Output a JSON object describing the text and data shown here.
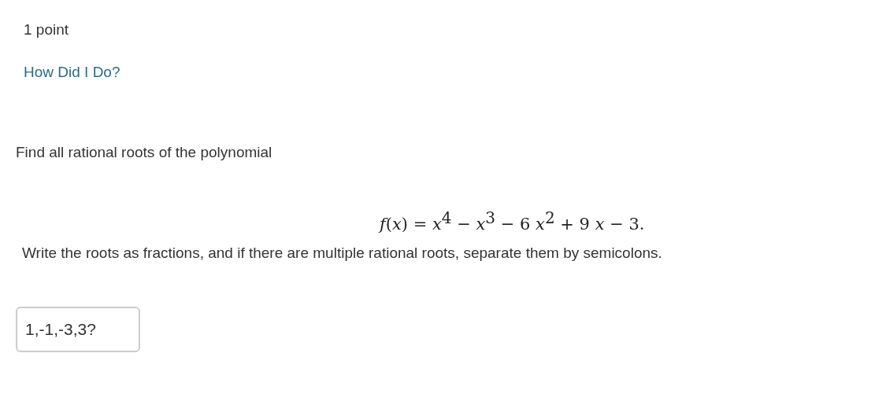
{
  "points": "1 point",
  "feedback_link": "How Did I Do?",
  "question": "Find all rational roots of the polynomial",
  "formula": "*f*(*x*) = *x*$^{4}$ − *x*$^{3}$ − 6 *x*$^{2}$ + 9 *x* − 3.",
  "instruction": "Write the roots as fractions, and if there are multiple rational roots, separate them by semicolons.",
  "answer": {
    "value": "1,-1,-3,3?"
  }
}
